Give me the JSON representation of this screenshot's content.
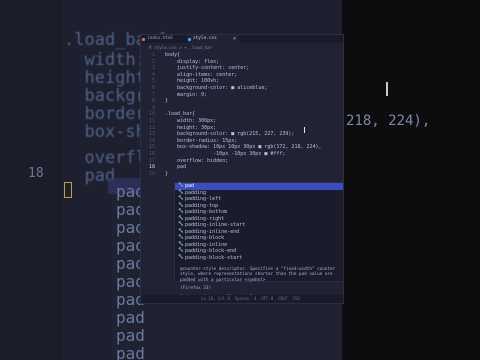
{
  "background": {
    "lines": [
      ".load_bar{",
      "  width: ",
      "  height:",
      "  backgro",
      "  border-",
      "  box-sha",
      "  overflo",
      "  pad"
    ],
    "line_number": "18",
    "right_fragment": "218, 224),",
    "suggestion_rows": [
      "pad",
      "pad",
      "pad",
      "pad",
      "pad",
      "pad",
      "pad",
      "pad",
      "pad",
      "pad"
    ]
  },
  "editor": {
    "tabs": [
      {
        "label": "index.html"
      },
      {
        "label": "style.css"
      }
    ],
    "close_glyph": "×",
    "breadcrumb": "# style.css > ✶ .load_bar",
    "lines": [
      {
        "num": "1",
        "text": "body{"
      },
      {
        "num": "2",
        "text": "    display: flex;"
      },
      {
        "num": "3",
        "text": "    justify-content: center;"
      },
      {
        "num": "4",
        "text": "    align-items: center;"
      },
      {
        "num": "5",
        "text": "    height: 100vh;"
      },
      {
        "num": "6",
        "text": "    background-color: ■ aliceblue;"
      },
      {
        "num": "7",
        "text": "    margin: 0;"
      },
      {
        "num": "8",
        "text": "}"
      },
      {
        "num": "9",
        "text": ""
      },
      {
        "num": "10",
        "text": ".load_bar{"
      },
      {
        "num": "11",
        "text": "    width: 300px;"
      },
      {
        "num": "12",
        "text": "    height: 30px;"
      },
      {
        "num": "13",
        "text": "    background-color: ■ rgb(215, 227, 239);"
      },
      {
        "num": "14",
        "text": "    border-radius: 15px;"
      },
      {
        "num": "15",
        "text": "    box-shadow: 10px 10px 30px ■ rgb(172, 218, 224),"
      },
      {
        "num": "16",
        "text": "                -10px -10px 30px ■ #fff;"
      },
      {
        "num": "17",
        "text": "    overflow: hidden;"
      },
      {
        "num": "18",
        "text": "    pad"
      },
      {
        "num": "19",
        "text": "}"
      }
    ],
    "suggestions": [
      "pad",
      "padding",
      "padding-left",
      "padding-top",
      "padding-bottom",
      "padding-right",
      "padding-inline-start",
      "padding-inline-end",
      "padding-block",
      "padding-inline",
      "padding-block-end",
      "padding-block-start"
    ],
    "doc": {
      "description": "@counter-style descriptor. Specifies a \"fixed-width\" counter style, where representations shorter than the pad value are padded with a particular <symbol>",
      "compat": "(Firefox 33)",
      "syntax": "Syntax: <integer> && <symbol>"
    },
    "status": "Ln 18, Col 8  Spaces: 4  UTF-8  CRLF  CSS"
  },
  "colors": {
    "accent": "#3d4bbd",
    "editor_bg": "#212234",
    "selector": "#ff9e64"
  }
}
